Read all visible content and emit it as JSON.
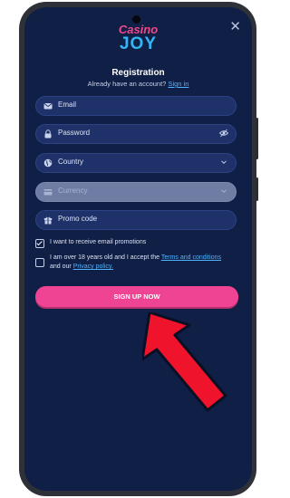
{
  "colors": {
    "screen_bg": "#0f1f45",
    "field_bg": "#1e3168",
    "accent_link": "#4fb3ff",
    "signup_bg": "#ef4494",
    "arrow": "#f0132c",
    "logo_pink": "#f0468a",
    "logo_blue": "#34b6f5"
  },
  "logo": {
    "line1": "Casino",
    "line2": "JOY"
  },
  "header": {
    "title": "Registration",
    "subtitle_prefix": "Already have an account?",
    "signin_link": "Sign in"
  },
  "fields": {
    "email": {
      "label": "Email",
      "icon": "mail-icon"
    },
    "password": {
      "label": "Password",
      "icon": "lock-icon",
      "trailing_icon": "eye-off-icon"
    },
    "country": {
      "label": "Country",
      "icon": "globe-icon",
      "trailing_icon": "chevron-down-icon"
    },
    "currency": {
      "label": "Currency",
      "icon": "card-icon",
      "trailing_icon": "chevron-down-icon",
      "disabled": true
    },
    "promo": {
      "label": "Promo code",
      "icon": "gift-icon"
    }
  },
  "consent": {
    "email_promotions": {
      "text": "I want to receive email promotions",
      "checked": true
    },
    "terms": {
      "checked": false,
      "text_a": "I am over 18 years old and I accept the",
      "terms_link": "Terms and conditions",
      "text_b": "and our",
      "privacy_link": "Privacy policy."
    }
  },
  "signup_button": "SIGN UP NOW",
  "annotation": {
    "icon": "arrow-up-icon"
  }
}
